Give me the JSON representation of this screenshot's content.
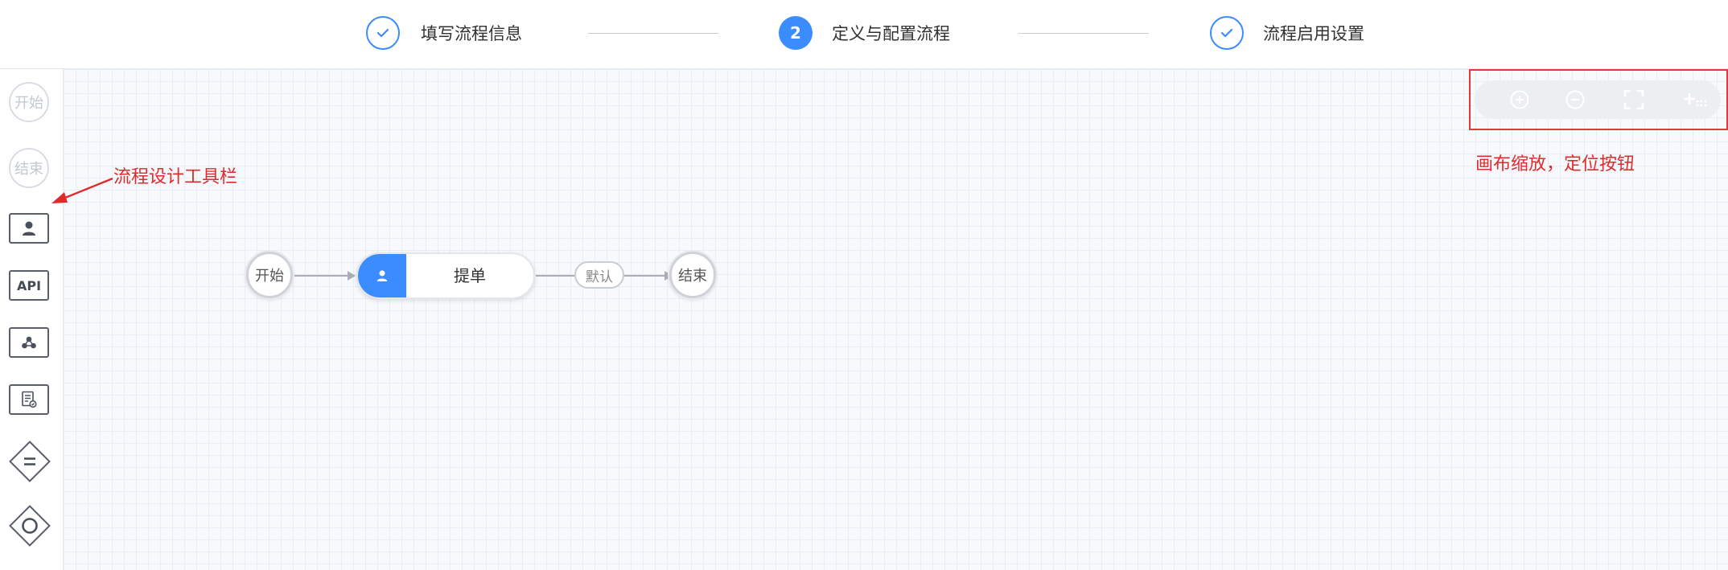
{
  "stepper": {
    "steps": [
      {
        "label": "填写流程信息",
        "state": "done"
      },
      {
        "label": "定义与配置流程",
        "state": "active",
        "number": "2"
      },
      {
        "label": "流程启用设置",
        "state": "done"
      }
    ]
  },
  "toolbar": {
    "start_label": "开始",
    "end_label": "结束",
    "api_label": "API",
    "items": [
      "user-task-icon",
      "api-task",
      "subprocess-icon",
      "form-icon",
      "exclusive-gateway-icon",
      "event-gateway-icon"
    ]
  },
  "canvas": {
    "start_node": "开始",
    "task_node": "提单",
    "edge_label": "默认",
    "end_node": "结束"
  },
  "zoom_controls": [
    "zoom-in-icon",
    "zoom-out-icon",
    "fit-screen-icon",
    "locate-icon"
  ],
  "annotations": {
    "toolbar_note": "流程设计工具栏",
    "zoom_note": "画布缩放，定位按钮"
  },
  "colors": {
    "primary": "#3b8cff",
    "annotation": "#e02b2b",
    "canvas_bg": "#f7f9fc"
  }
}
